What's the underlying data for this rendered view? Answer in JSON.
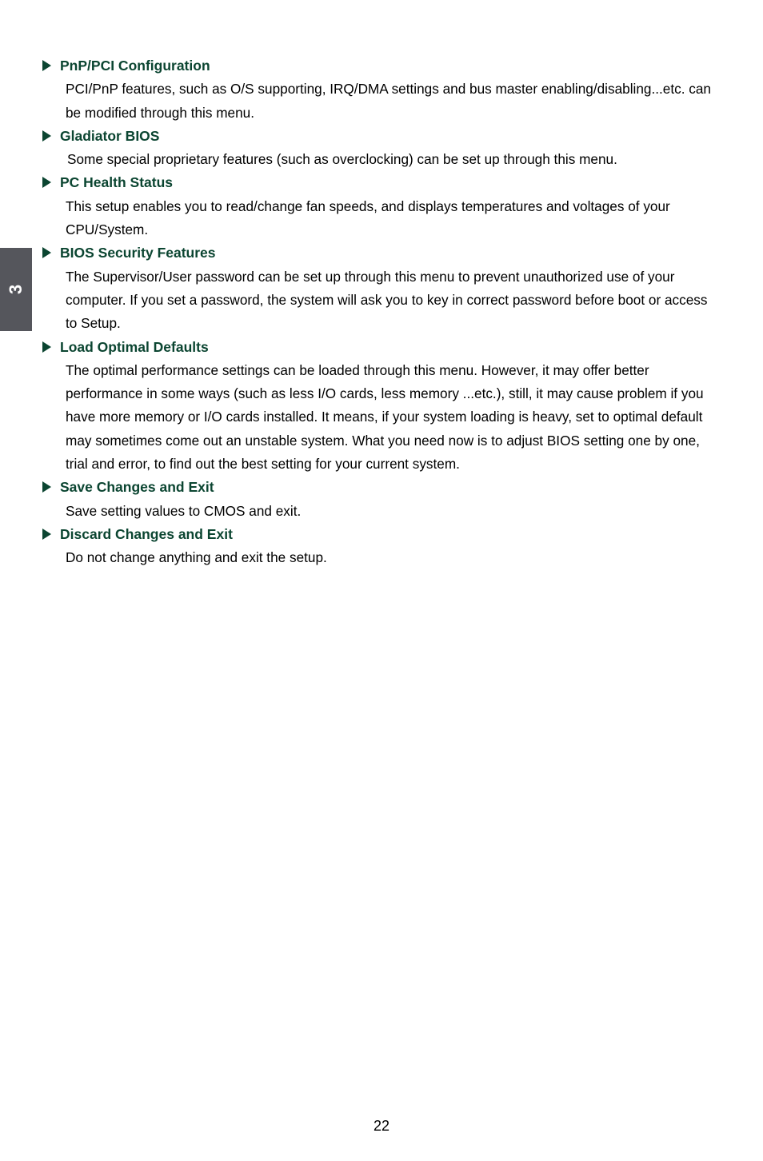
{
  "chapter_tab": {
    "number": "3",
    "color": "#55565c"
  },
  "theme": {
    "heading_color": "#0b4531",
    "body_color": "#000000",
    "background": "#ffffff"
  },
  "entries": [
    {
      "heading": "PnP/PCI Configuration",
      "body": "PCI/PnP features, such as O/S supporting, IRQ/DMA settings and bus master enabling/disabling...etc. can be modified through this menu."
    },
    {
      "heading": "Gladiator BIOS",
      "body": "Some special proprietary features (such as overclocking) can be set up through this menu."
    },
    {
      "heading": "PC Health Status",
      "body": "This setup enables you to read/change fan speeds, and displays temperatures and voltages of your CPU/System."
    },
    {
      "heading": "BIOS Security Features",
      "body": "The Supervisor/User password can be set up through this menu to prevent unauthorized use of your computer. If you set a password, the system will ask you to key in correct password before boot or access to Setup."
    },
    {
      "heading": "Load Optimal Defaults",
      "body": "The optimal performance settings can be loaded through this menu. However, it may offer better performance in some ways (such as less I/O cards, less memory ...etc.), still, it may cause problem if you have more memory or I/O cards installed. It means, if your system loading is heavy, set to optimal default may sometimes come out an unstable system. What you need now is to adjust BIOS setting one by one, trial and error, to find out the best setting for your current system."
    },
    {
      "heading": "Save Changes and Exit",
      "body": "Save setting values to CMOS and exit."
    },
    {
      "heading": "Discard Changes and Exit",
      "body": "Do not change anything and exit the setup."
    }
  ],
  "footer": {
    "page_number": "22"
  }
}
